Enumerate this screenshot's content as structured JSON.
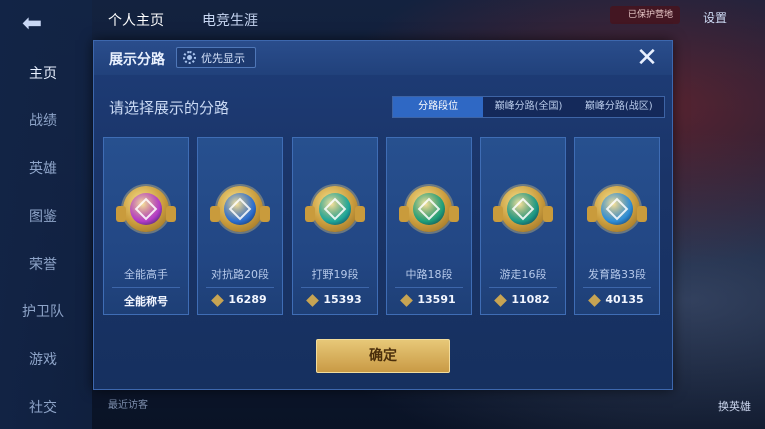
{
  "left_nav": {
    "items": [
      "主页",
      "战绩",
      "英雄",
      "图鉴",
      "荣誉",
      "护卫队",
      "游戏",
      "社交"
    ]
  },
  "top_tabs": [
    "个人主页",
    "电竞生涯"
  ],
  "top_right": {
    "tag_text": "已保护营地",
    "settings_label": "设置"
  },
  "bottom": {
    "recent_visitors": "最近访客",
    "switch_hero": "换英雄"
  },
  "dialog": {
    "title": "展示分路",
    "priority_label": "优先显示",
    "subtitle": "请选择展示的分路",
    "segments": [
      "分路段位",
      "巅峰分路(全国)",
      "巅峰分路(战区)"
    ],
    "active_segment": 0,
    "cards": [
      {
        "role": "全能高手",
        "score": "全能称号",
        "show_icon": false,
        "color": "#b43cc8"
      },
      {
        "role": "对抗路20段",
        "score": "16289",
        "show_icon": true,
        "color": "#2d6fd0"
      },
      {
        "role": "打野19段",
        "score": "15393",
        "show_icon": true,
        "color": "#1fa89a"
      },
      {
        "role": "中路18段",
        "score": "13591",
        "show_icon": true,
        "color": "#1fa07a"
      },
      {
        "role": "游走16段",
        "score": "11082",
        "show_icon": true,
        "color": "#1c9a86"
      },
      {
        "role": "发育路33段",
        "score": "40135",
        "show_icon": true,
        "color": "#2f8fd8"
      }
    ],
    "confirm_label": "确定"
  },
  "icons": {
    "back": "back-arrow-icon",
    "close": "close-icon",
    "gear": "gear-icon",
    "score": "diamond-icon"
  }
}
